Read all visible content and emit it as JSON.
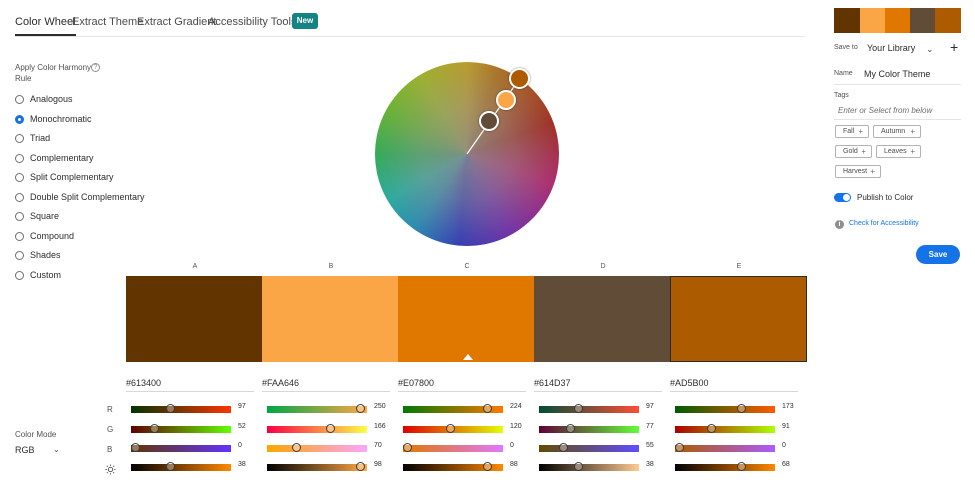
{
  "tabs": [
    {
      "label": "Color Wheel"
    },
    {
      "label": "Extract Theme"
    },
    {
      "label": "Extract Gradient"
    },
    {
      "label": "Accessibility Tools"
    }
  ],
  "badge": "New",
  "harmony": {
    "label": "Apply Color Harmony Rule",
    "selected": "Monochromatic",
    "rules": [
      "Analogous",
      "Monochromatic",
      "Triad",
      "Complementary",
      "Split Complementary",
      "Double Split Complementary",
      "Square",
      "Compound",
      "Shades",
      "Custom"
    ]
  },
  "theme": {
    "selected_index": 2,
    "swatches": [
      {
        "letter": "A",
        "hex": "#613400",
        "color": "#613400",
        "values": {
          "r": 97,
          "g": 52,
          "b": 0,
          "brightness": 38
        }
      },
      {
        "letter": "B",
        "hex": "#FAA646",
        "color": "#FAA646",
        "values": {
          "r": 250,
          "g": 166,
          "b": 70,
          "brightness": 98
        }
      },
      {
        "letter": "C",
        "hex": "#E07800",
        "color": "#E07800",
        "values": {
          "r": 224,
          "g": 120,
          "b": 0,
          "brightness": 88
        }
      },
      {
        "letter": "D",
        "hex": "#614D37",
        "color": "#614D37",
        "values": {
          "r": 97,
          "g": 77,
          "b": 55,
          "brightness": 38
        }
      },
      {
        "letter": "E",
        "hex": "#AD5B00",
        "color": "#AD5B00",
        "values": {
          "r": 173,
          "g": 91,
          "b": 0,
          "brightness": 68
        }
      }
    ]
  },
  "channels": [
    "R",
    "G",
    "B"
  ],
  "color_mode": {
    "label": "Color Mode",
    "value": "RGB"
  },
  "panel": {
    "save_to_label": "Save to",
    "library": "Your Library",
    "name_label": "Name",
    "name_value": "My Color Theme",
    "tags_label": "Tags",
    "tags_placeholder": "Enter or Select from below",
    "tags": [
      "Fall",
      "Autumn",
      "Gold",
      "Leaves",
      "Harvest"
    ],
    "publish_label": "Publish to Color",
    "publish_on": true,
    "accessibility_link": "Check for Accessibility",
    "save_label": "Save"
  }
}
